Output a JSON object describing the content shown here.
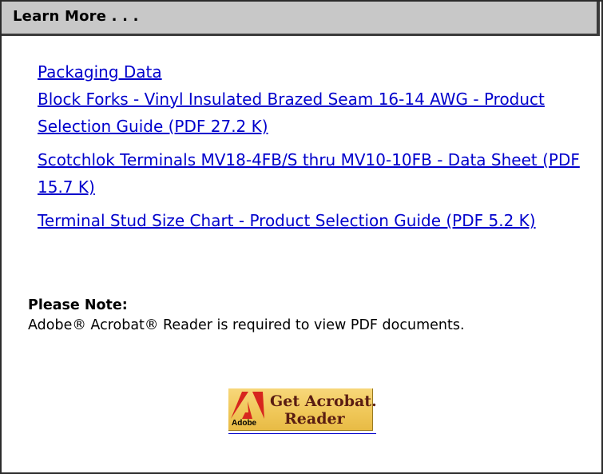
{
  "panel": {
    "header_title": "Learn More . . ."
  },
  "links": [
    {
      "text": "Packaging Data"
    },
    {
      "text": "Block Forks - Vinyl Insulated Brazed Seam 16-14 AWG - Product Selection Guide (PDF 27.2 K)"
    },
    {
      "text": "Scotchlok Terminals MV18-4FB/S thru MV10-10FB - Data Sheet (PDF 15.7 K)"
    },
    {
      "text": "Terminal Stud Size Chart - Product Selection Guide (PDF 5.2 K)"
    }
  ],
  "note": {
    "label": "Please Note:",
    "text": "Adobe® Acrobat® Reader is required to view PDF documents."
  },
  "acrobat_badge": {
    "line1": "Get Acrobat.",
    "line2": "Reader",
    "brand": "Adobe",
    "icon": "adobe-logo-icon",
    "colors": {
      "background": "#f0c85a",
      "logo": "#d7261e",
      "text": "#5a1d12"
    }
  },
  "colors": {
    "link": "#0000cc",
    "header_background": "#c8c8c8"
  }
}
